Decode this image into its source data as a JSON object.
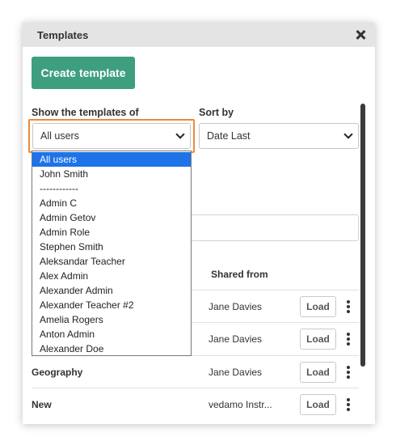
{
  "dialog": {
    "title": "Templates"
  },
  "create_button": "Create template",
  "filters": {
    "show_label": "Show the templates of",
    "show_value": "All users",
    "sort_label": "Sort by",
    "sort_value": "Date Last"
  },
  "dropdown": {
    "options": [
      "All users",
      "John Smith",
      "------------",
      "Admin C",
      "Admin Getov",
      "Admin Role",
      "Stephen Smith",
      "Aleksandar Teacher",
      "Alex Admin",
      "Alexander Admin",
      "Alexander Teacher #2",
      "Amelia Rogers",
      "Anton Admin",
      "Alexander Doe"
    ],
    "selected_index": 0
  },
  "table": {
    "shared_header": "Shared from",
    "rows": [
      {
        "name": "",
        "shared": "Jane Davies",
        "load": "Load"
      },
      {
        "name": "",
        "shared": "Jane Davies",
        "load": "Load"
      },
      {
        "name": "Geography",
        "shared": "Jane Davies",
        "load": "Load"
      },
      {
        "name": "New",
        "shared": "vedamo Instr...",
        "load": "Load"
      }
    ]
  },
  "colors": {
    "accent": "#3e9e80",
    "highlight": "#ec8a3a",
    "selected_option": "#1e73e8"
  }
}
